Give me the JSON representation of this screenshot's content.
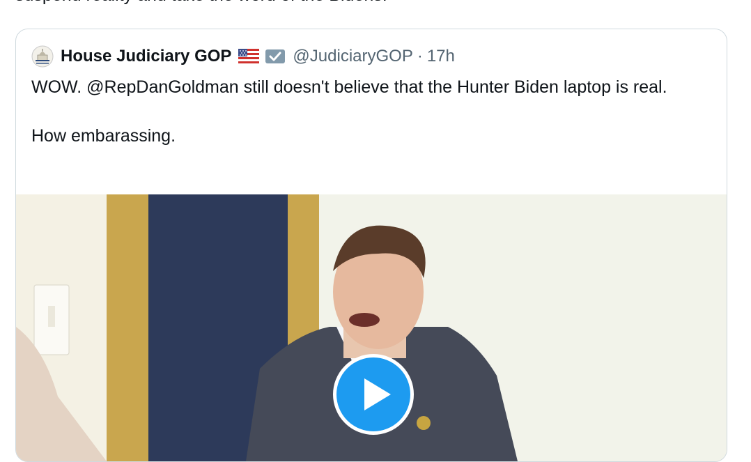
{
  "top_text": "suspend reality and take the word of the Bidens.",
  "quote": {
    "author_name": "House Judiciary GOP",
    "handle": "@JudiciaryGOP",
    "separator": "·",
    "time": "17h",
    "text_line1": "WOW. @RepDanGoldman still doesn't believe that the Hunter Biden laptop is real.",
    "text_line2": "How embarassing.",
    "icons": {
      "avatar": "house-judiciary-seal-icon",
      "flag": "us-flag-icon",
      "badge": "government-badge-icon",
      "play": "play-icon"
    },
    "colors": {
      "play_button": "#1d9bf0",
      "handle": "#536471",
      "border": "#cfd9de"
    }
  }
}
